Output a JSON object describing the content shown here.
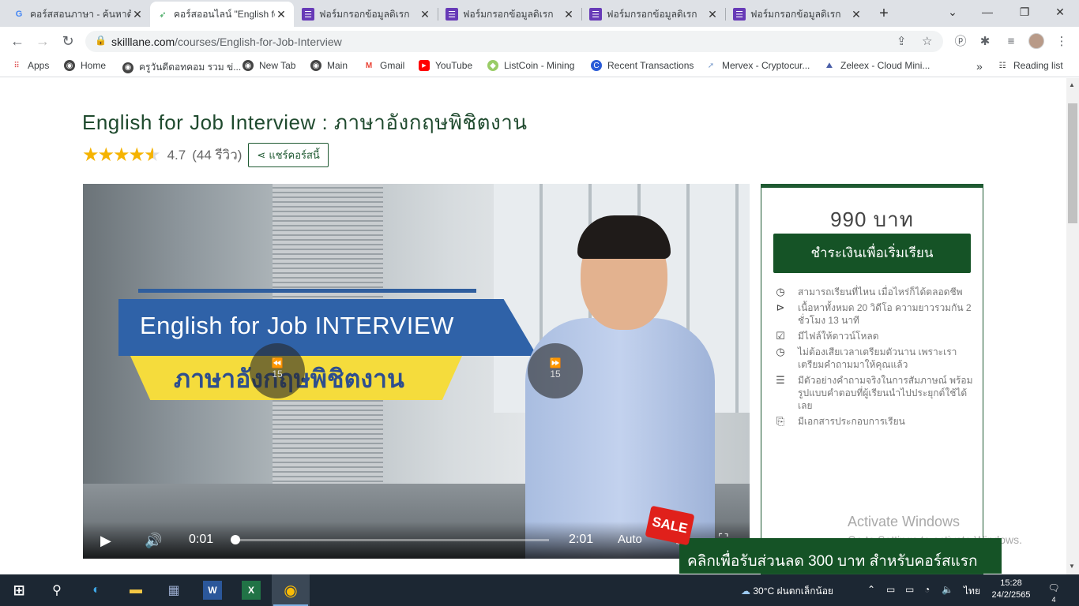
{
  "browser": {
    "tabs": [
      {
        "title": "คอร์สสอนภาษา - ค้นหาด้",
        "icon": "google-icon",
        "active": false
      },
      {
        "title": "คอร์สออนไลน์ \"English fo",
        "icon": "skilllane-icon",
        "active": true
      },
      {
        "title": "ฟอร์มกรอกข้อมูลดิเรก",
        "icon": "forms-icon",
        "active": false
      },
      {
        "title": "ฟอร์มกรอกข้อมูลดิเรก",
        "icon": "forms-icon",
        "active": false
      },
      {
        "title": "ฟอร์มกรอกข้อมูลดิเรก",
        "icon": "forms-icon",
        "active": false
      },
      {
        "title": "ฟอร์มกรอกข้อมูลดิเรก",
        "icon": "forms-icon",
        "active": false
      }
    ],
    "url_domain": "skilllane.com",
    "url_path": "/courses/English-for-Job-Interview",
    "bookmarks": [
      {
        "label": "Apps",
        "icon": "apps-grid-icon"
      },
      {
        "label": "Home",
        "icon": "globe-icon"
      },
      {
        "label": "ครูวันดีดอทคอม รวม ข่...",
        "icon": "globe-icon"
      },
      {
        "label": "New Tab",
        "icon": "globe-icon"
      },
      {
        "label": "Main",
        "icon": "globe-icon"
      },
      {
        "label": "Gmail",
        "icon": "gmail-icon"
      },
      {
        "label": "YouTube",
        "icon": "youtube-icon"
      },
      {
        "label": "ListCoin - Mining",
        "icon": "listcoin-icon"
      },
      {
        "label": "Recent Transactions",
        "icon": "coin-icon"
      },
      {
        "label": "Mervex - Cryptocur...",
        "icon": "mervex-icon"
      },
      {
        "label": "Zeleex - Cloud Mini...",
        "icon": "zeleex-icon"
      }
    ],
    "more_bookmarks": "»",
    "reading_list": "Reading list"
  },
  "course": {
    "title": "English for Job Interview : ภาษาอังกฤษพิชิตงาน",
    "rating": "4.7",
    "reviews": "(44 รีวิว)",
    "share_label": "แชร์คอร์สนี้",
    "stars": 4.7
  },
  "video": {
    "banner_en": "English for Job INTERVIEW",
    "banner_th": "ภาษาอังกฤษพิชิตงาน",
    "skip_back": "15",
    "skip_forward": "15",
    "current_time": "0:01",
    "duration": "2:01",
    "quality": "Auto",
    "progress": 0.008
  },
  "purchase": {
    "price": "990 บาท",
    "buy_label": "ชำระเงินเพื่อเริ่มเรียน",
    "features": [
      {
        "icon": "clock-icon",
        "text": "สามารถเรียนที่ไหน เมื่อไหร่ก็ได้ตลอดชีพ"
      },
      {
        "icon": "play-circle-icon",
        "text": "เนื้อหาทั้งหมด 20 วิดีโอ ความยาวรวมกัน 2 ชั่วโมง 13 นาที"
      },
      {
        "icon": "checkbox-icon",
        "text": "มีไฟล์ให้ดาวน์โหลด"
      },
      {
        "icon": "clock-icon",
        "text": "ไม่ต้องเสียเวลาเตรียมตัวนาน เพราะเราเตรียมคำถามมาให้คุณแล้ว"
      },
      {
        "icon": "list-icon",
        "text": "มีตัวอย่างคำถามจริงในการสัมภาษณ์ พร้อมรูปแบบคำตอบที่ผู้เรียนนำไปประยุกต์ใช้ได้เลย"
      },
      {
        "icon": "paperclip-icon",
        "text": "มีเอกสารประกอบการเรียน"
      }
    ]
  },
  "promo": {
    "sale_label": "SALE",
    "text": "คลิกเพื่อรับส่วนลด 300 บาท สำหรับคอร์สแรก"
  },
  "watermark": {
    "line1": "Activate Windows",
    "line2": "Go to Settings to activate Windows."
  },
  "taskbar": {
    "weather": "30°C ฝนตกเล็กน้อย",
    "language": "ไทย",
    "time": "15:28",
    "date": "24/2/2565",
    "notifications": "4"
  },
  "colors": {
    "brand_green": "#155326",
    "star": "#f5b301",
    "sale_red": "#e0201b"
  }
}
